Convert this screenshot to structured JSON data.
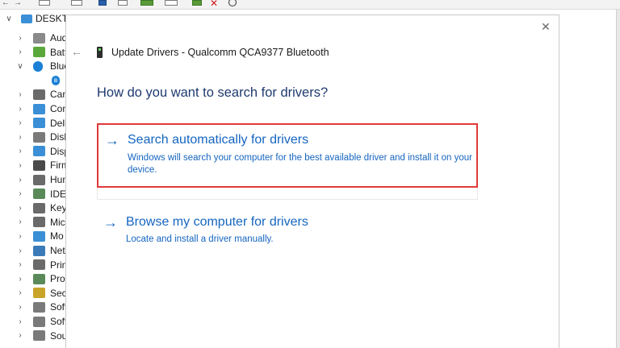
{
  "toolbar": {
    "items": [
      "back-icon",
      "forward-icon",
      "properties-icon",
      "help-icon",
      "update-driver-icon",
      "scan-icon",
      "enable-icon",
      "uninstall-icon",
      "download-icon"
    ],
    "colors": {
      "uninstall": "#d11a1a",
      "green": "#5a9a3a",
      "blue": "#2b5fa8"
    }
  },
  "tree": {
    "root_label": "DESKTO",
    "items": [
      {
        "label": "Aud",
        "icon": "speaker-icon",
        "color": "#8a8a8a",
        "expanded": false
      },
      {
        "label": "Batt",
        "icon": "battery-icon",
        "color": "#5aa83a",
        "expanded": false
      },
      {
        "label": "Blue",
        "icon": "bluetooth-icon",
        "color": "#1b7fd6",
        "expanded": true
      },
      {
        "label": "",
        "icon": "bluetooth-device-icon",
        "color": "#1b7fd6",
        "child": true
      },
      {
        "label": "Can",
        "icon": "camera-icon",
        "color": "#6a6a6a",
        "expanded": false
      },
      {
        "label": "Con",
        "icon": "computer-icon",
        "color": "#3a8fd6",
        "expanded": false
      },
      {
        "label": "Dell",
        "icon": "monitor-icon",
        "color": "#3a8fd6",
        "expanded": false
      },
      {
        "label": "Disk",
        "icon": "disk-drive-icon",
        "color": "#7a7a7a",
        "expanded": false
      },
      {
        "label": "Disp",
        "icon": "display-adapter-icon",
        "color": "#3a8fd6",
        "expanded": false
      },
      {
        "label": "Firm",
        "icon": "firmware-icon",
        "color": "#4a4a4a",
        "expanded": false
      },
      {
        "label": "Hun",
        "icon": "hid-icon",
        "color": "#6a6a6a",
        "expanded": false
      },
      {
        "label": "IDE",
        "icon": "ide-controller-icon",
        "color": "#5a8a5a",
        "expanded": false
      },
      {
        "label": "Key",
        "icon": "keyboard-icon",
        "color": "#6a6a6a",
        "expanded": false
      },
      {
        "label": "Mic",
        "icon": "mouse-icon",
        "color": "#6a6a6a",
        "expanded": false
      },
      {
        "label": "Mo",
        "icon": "monitor-icon",
        "color": "#3a8fd6",
        "expanded": false
      },
      {
        "label": "Net",
        "icon": "network-icon",
        "color": "#3a7ab8",
        "expanded": false
      },
      {
        "label": "Prin",
        "icon": "printer-icon",
        "color": "#6a6a6a",
        "expanded": false
      },
      {
        "label": "Pro",
        "icon": "processor-icon",
        "color": "#5a8a5a",
        "expanded": false
      },
      {
        "label": "Sec",
        "icon": "security-icon",
        "color": "#c8a428",
        "expanded": false
      },
      {
        "label": "Soft",
        "icon": "software-component-icon",
        "color": "#7a7a7a",
        "expanded": false
      },
      {
        "label": "Soft",
        "icon": "software-device-icon",
        "color": "#7a7a7a",
        "expanded": false
      },
      {
        "label": "Sou",
        "icon": "sound-icon",
        "color": "#7a7a7a",
        "expanded": false
      }
    ]
  },
  "dialog": {
    "title": "Update Drivers - Qualcomm QCA9377 Bluetooth",
    "question": "How do you want to search for drivers?",
    "options": [
      {
        "heading": "Search automatically for drivers",
        "description": "Windows will search your computer for the best available driver and install it on your device.",
        "highlighted": true
      },
      {
        "heading": "Browse my computer for drivers",
        "description": "Locate and install a driver manually.",
        "highlighted": false
      }
    ],
    "colors": {
      "link": "#1565c0",
      "question": "#1f3a70",
      "highlight": "#e0393a"
    }
  }
}
